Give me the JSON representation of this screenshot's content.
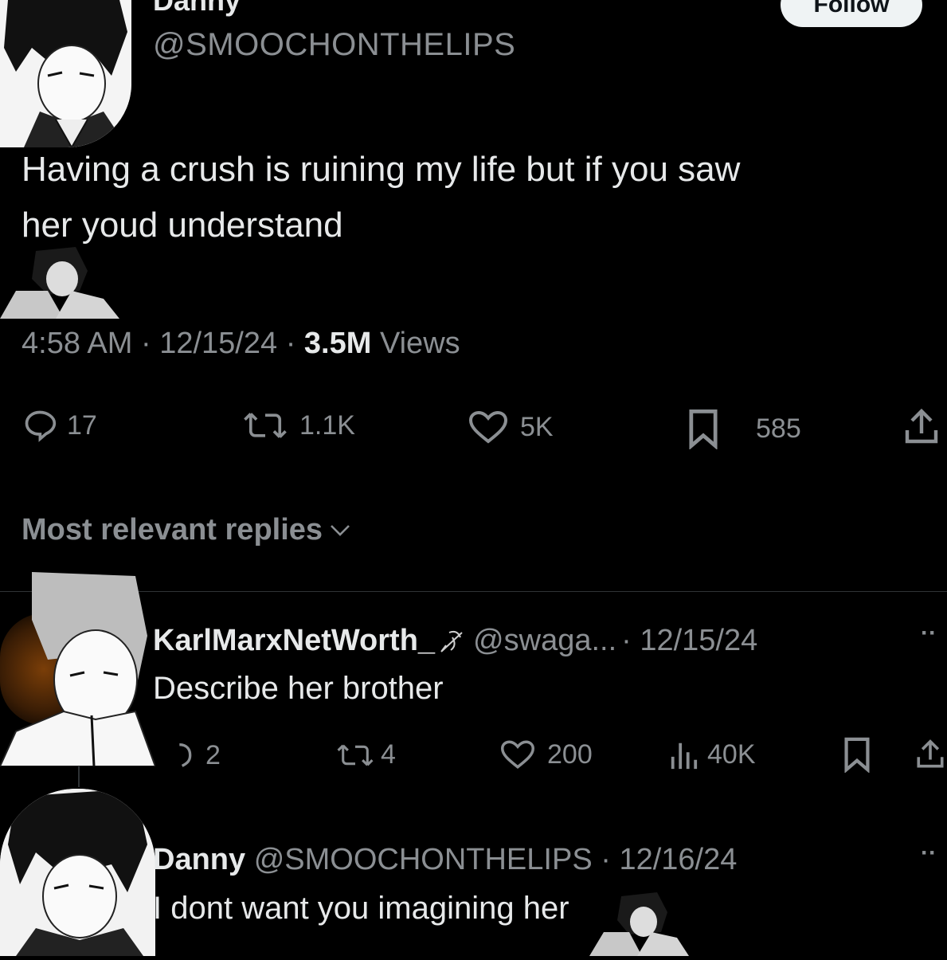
{
  "tweet": {
    "display_name": "Danny",
    "handle": "@SMOOCHONTHELIPS",
    "follow_label": "Follow",
    "text_line1": "Having a crush is ruining my life but if you saw",
    "text_line2": "her youd understand",
    "time": "4:58 AM",
    "sep1": "·",
    "date": "12/15/24",
    "sep2": "·",
    "views_count": "3.5M",
    "views_label": "Views",
    "replies": "17",
    "retweets": "1.1K",
    "likes": "5K",
    "bookmarks": "585"
  },
  "replies_filter": {
    "label": "Most relevant replies"
  },
  "replies": [
    {
      "display_name": "KarlMarxNetWorth_",
      "handle": "@swaga...",
      "date": "· 12/15/24",
      "more": "··",
      "text": "Describe her brother",
      "replies": "2",
      "retweets": "4",
      "likes": "200",
      "views": "40K"
    },
    {
      "display_name": "Danny",
      "handle": "@SMOOCHONTHELIPS",
      "date": "· 12/16/24",
      "more": "··",
      "text": "I dont want you imagining her"
    }
  ],
  "icons": {
    "reply": "reply-icon",
    "retweet": "retweet-icon",
    "like": "heart-icon",
    "bookmark": "bookmark-icon",
    "share": "share-icon",
    "views": "views-icon",
    "verified": "bird-badge-icon",
    "chevron": "chevron-down-icon",
    "more": "more-icon"
  },
  "colors": {
    "background": "#000000",
    "text": "#e7e9ea",
    "secondary": "#8b8f93",
    "divider": "#2f3336",
    "follow_bg": "#eff3f4"
  }
}
